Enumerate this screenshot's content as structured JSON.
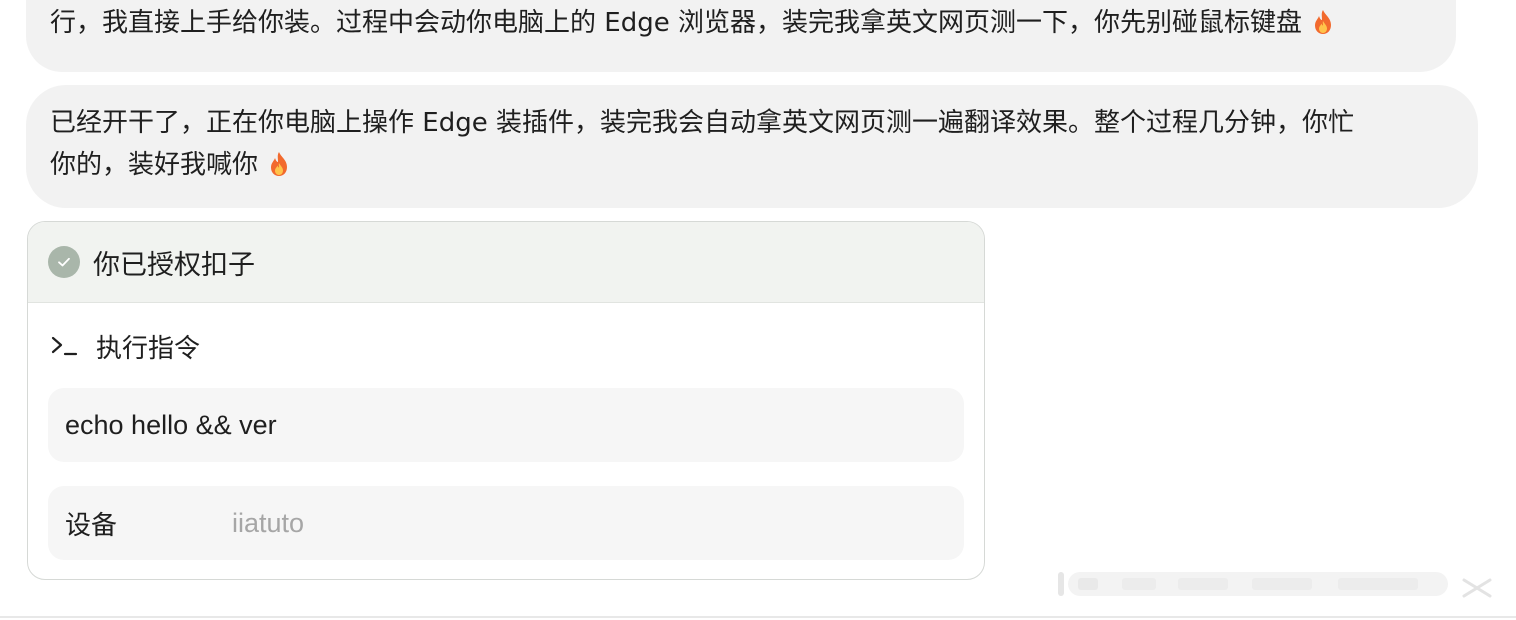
{
  "messages": [
    {
      "text": "行，我直接上手给你装。过程中会动你电脑上的 Edge 浏览器，装完我拿英文网页测一下，你先别碰鼠标键盘",
      "emoji": "fire-icon"
    },
    {
      "line1": "已经开干了，正在你电脑上操作 Edge 装插件，装完我会自动拿英文网页测一遍翻译效果。整个过程几分钟，你忙",
      "line2": "你的，装好我喊你",
      "emoji": "fire-icon"
    }
  ],
  "card": {
    "header_label": "你已授权扣子",
    "header_icon": "check-circle-icon",
    "action_icon": "terminal-icon",
    "action_label": "执行指令",
    "command": "echo hello && ver",
    "device_label": "设备",
    "device_value": "iiatuto"
  },
  "colors": {
    "bubble_bg": "#f2f2f2",
    "card_header_bg": "#f1f3f0",
    "check_bg": "#a9b6aa",
    "field_bg": "#f6f6f6",
    "muted_text": "#a6a6a6"
  }
}
